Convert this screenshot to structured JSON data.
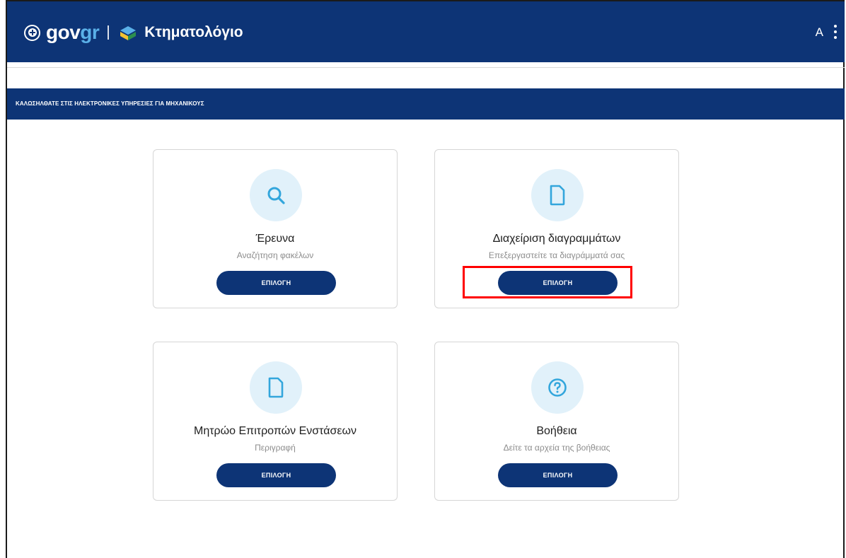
{
  "header": {
    "gov_logo_text": "gov",
    "gov_logo_accent": "gr",
    "app_title": "Κτηματολόγιο",
    "user_initial": "A"
  },
  "banner": {
    "text": "ΚΑΛΩΣΗΛΘΑΤΕ ΣΤΙΣ ΗΛΕΚΤΡΟΝΙΚΕΣ ΥΠΗΡΕΣΙΕΣ ΓΙΑ ΜΗΧΑΝΙΚΟΥΣ"
  },
  "cards": [
    {
      "icon": "search-icon",
      "title": "Έρευνα",
      "description": "Αναζήτηση φακέλων",
      "button": "ΕΠΙΛΟΓΗ"
    },
    {
      "icon": "document-icon",
      "title": "Διαχείριση διαγραμμάτων",
      "description": "Επεξεργαστείτε τα διαγράμματά σας",
      "button": "ΕΠΙΛΟΓΗ"
    },
    {
      "icon": "document-icon",
      "title": "Μητρώο Επιτροπών Ενστάσεων",
      "description": "Περιγραφή",
      "button": "ΕΠΙΛΟΓΗ"
    },
    {
      "icon": "help-icon",
      "title": "Βοήθεια",
      "description": "Δείτε τα αρχεία της βοήθειας",
      "button": "ΕΠΙΛΟΓΗ"
    }
  ],
  "colors": {
    "primary": "#0d3476",
    "accent": "#5ab0e8",
    "icon_bg": "#e1f1fa",
    "icon": "#33a6dc",
    "highlight": "#ff0000"
  }
}
